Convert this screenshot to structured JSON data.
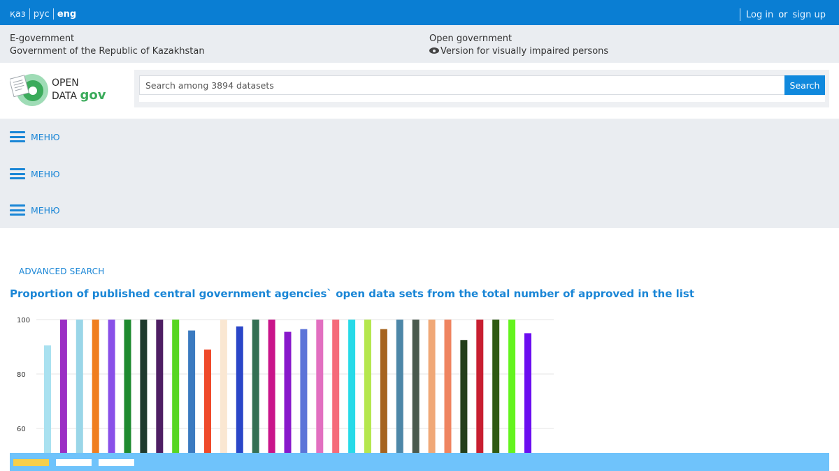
{
  "topbar": {
    "langs": [
      "қаз",
      "рус",
      "eng"
    ],
    "active_lang": "eng",
    "login": "Log in",
    "or": "or",
    "signup": "sign up"
  },
  "infobar": {
    "egov": "E-government",
    "gov": "Government of the Republic of Kazakhstan",
    "open_gov": "Open government",
    "impaired": "Version for visually impaired persons"
  },
  "logo": {
    "line1": "OPEN",
    "line2_prefix": "DATA",
    "line2_suffix": "gov"
  },
  "search": {
    "placeholder": "Search among 3894 datasets",
    "button": "Search"
  },
  "menus": [
    "МЕНЮ",
    "МЕНЮ",
    "МЕНЮ"
  ],
  "advanced_search": "ADVANCED SEARCH",
  "chart_title": "Proportion of published central government agencies` open data sets from the total number of approved in the list",
  "colors": {
    "brand_blue": "#0a7ed3",
    "link_blue": "#1a86d6",
    "panel_grey": "#eaedf1",
    "footer_strip": "#6fc3fb",
    "footer_accent": "#f7cf4b"
  },
  "chart_data": {
    "type": "bar",
    "title": "Proportion of published central government agencies` open data sets from the total number of approved in the list",
    "xlabel": "",
    "ylabel": "",
    "ylim": [
      55,
      100
    ],
    "yticks": [
      100,
      80,
      60
    ],
    "grid": true,
    "values": [
      90.5,
      100,
      100,
      100,
      100,
      100,
      100,
      100,
      100,
      96,
      89,
      100,
      97.5,
      100,
      100,
      95.5,
      96.5,
      100,
      100,
      100,
      100,
      96.5,
      100,
      100,
      100,
      100,
      92.5,
      100,
      100,
      100,
      95
    ],
    "colors": [
      "#a9e1f0",
      "#9b2fc4",
      "#9ad6e8",
      "#f07e1e",
      "#8950e8",
      "#1e8a2f",
      "#1f3a2d",
      "#4e1e63",
      "#57d621",
      "#3a7ac0",
      "#ef4a2a",
      "#fae7d2",
      "#2a46c8",
      "#347054",
      "#c9148a",
      "#8818cb",
      "#5c74d8",
      "#e26fc0",
      "#f56b7a",
      "#27dae8",
      "#b5e74e",
      "#a6641f",
      "#4d87a8",
      "#4a5a4e",
      "#f0a877",
      "#ef8460",
      "#243f1b",
      "#c81e30",
      "#2f5a12",
      "#64f41e",
      "#6b0df0"
    ]
  }
}
